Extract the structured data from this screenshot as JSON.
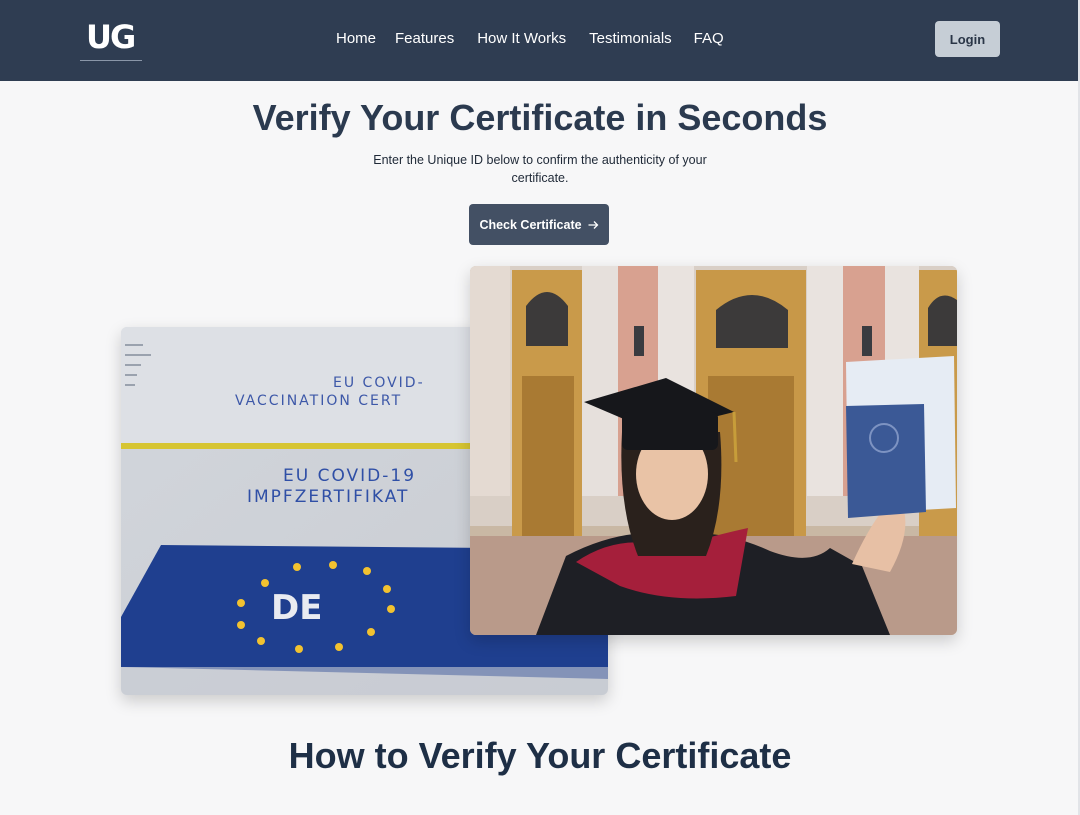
{
  "header": {
    "logo_text": "UG",
    "nav": [
      "Home",
      "Features",
      "How It Works",
      "Testimonials",
      "FAQ"
    ],
    "login_label": "Login"
  },
  "hero": {
    "title": "Verify Your Certificate in Seconds",
    "subtitle": "Enter the Unique ID below to confirm the authenticity of your certificate.",
    "cta_label": "Check Certificate",
    "cta_icon": "arrow-right-icon"
  },
  "images": {
    "left": {
      "line1": "EU COVID-",
      "line2": "VACCINATION CERT",
      "line3": "EU COVID-19",
      "line4": "IMPFZERTIFIKAT",
      "badge": "DE"
    }
  },
  "sections": {
    "how_title": "How to Verify Your Certificate"
  },
  "colors": {
    "header_bg": "#2f3d52",
    "cta_bg": "#435064",
    "login_bg": "#c6ced6",
    "page_bg": "#f7f7f8"
  }
}
